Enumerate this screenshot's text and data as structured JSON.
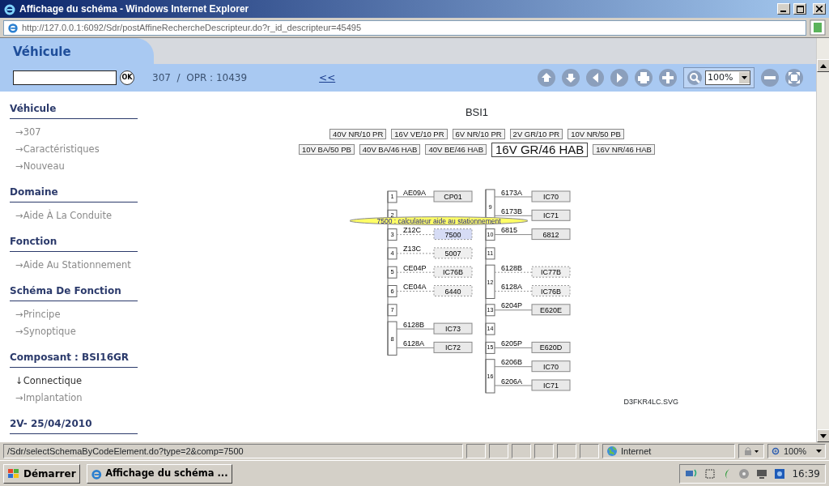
{
  "window": {
    "title": "Affichage du schéma - Windows Internet Explorer"
  },
  "address_bar": {
    "url": "http://127.0.0.1:6092/Sdr/postAffineRechercheDescripteur.do?r_id_descripteur=45495"
  },
  "app": {
    "tab": "Véhicule",
    "ok_button": "OK",
    "breadcrumb": "307  /  OPR : 10439",
    "back_link": "<<",
    "zoom": "100%"
  },
  "sidebar": {
    "sections": [
      {
        "title": "Véhicule",
        "items": [
          {
            "arrow": "→",
            "label": "307",
            "selected": false
          },
          {
            "arrow": "→",
            "label": "Caractéristiques",
            "selected": false
          },
          {
            "arrow": "→",
            "label": "Nouveau",
            "selected": false
          }
        ]
      },
      {
        "title": "Domaine",
        "items": [
          {
            "arrow": "→",
            "label": "Aide À La Conduite",
            "selected": false
          }
        ]
      },
      {
        "title": "Fonction",
        "items": [
          {
            "arrow": "→",
            "label": "Aide Au Stationnement",
            "selected": false
          }
        ]
      },
      {
        "title": "Schéma De Fonction",
        "items": [
          {
            "arrow": "→",
            "label": "Principe",
            "selected": false
          },
          {
            "arrow": "→",
            "label": "Synoptique",
            "selected": false
          }
        ]
      },
      {
        "title": "Composant : BSI16GR",
        "items": [
          {
            "arrow": "↓",
            "label": "Connectique",
            "selected": true
          },
          {
            "arrow": "→",
            "label": "Implantation",
            "selected": false
          }
        ]
      },
      {
        "title": "2V- 25/04/2010"
      }
    ]
  },
  "diagram": {
    "title": "BSI1",
    "variant_rows": [
      {
        "variants": [
          {
            "label": "40V NR/10 PR",
            "selected": false
          },
          {
            "label": "16V VE/10 PR",
            "selected": false
          },
          {
            "label": "6V NR/10 PR",
            "selected": false
          },
          {
            "label": "2V GR/10 PR",
            "selected": false
          },
          {
            "label": "10V NR/50 PB",
            "selected": false
          }
        ]
      },
      {
        "variants": [
          {
            "label": "10V BA/50 PB",
            "selected": false
          },
          {
            "label": "40V BA/46 HAB",
            "selected": false
          },
          {
            "label": "40V BE/46 HAB",
            "selected": false
          },
          {
            "label": "16V GR/46 HAB",
            "selected": true
          },
          {
            "label": "16V NR/46 HAB",
            "selected": false
          }
        ]
      }
    ],
    "connectors": [
      {
        "pins": [
          {
            "number": "1",
            "wires": [
              {
                "label": "AE09A",
                "target": "CP01",
                "dashed": false,
                "highlighted": false
              }
            ]
          },
          {
            "number": "2"
          },
          {
            "number": "3",
            "wires": [
              {
                "label": "Z12C",
                "target": "7500",
                "dashed": true,
                "highlighted": true
              }
            ]
          },
          {
            "number": "4",
            "wires": [
              {
                "label": "Z13C",
                "target": "5007",
                "dashed": true,
                "highlighted": false
              }
            ]
          },
          {
            "number": "5",
            "wires": [
              {
                "label": "CE04P",
                "target": "IC76B",
                "dashed": true,
                "highlighted": false
              }
            ]
          },
          {
            "number": "6",
            "wires": [
              {
                "label": "CE04A",
                "target": "6440",
                "dashed": true,
                "highlighted": false
              }
            ]
          },
          {
            "number": "7"
          },
          {
            "number": "8",
            "wires": [
              {
                "label": "6128B",
                "target": "IC73",
                "dashed": false,
                "highlighted": false
              },
              {
                "label": "6128A",
                "target": "IC72",
                "dashed": false,
                "highlighted": false
              }
            ]
          }
        ]
      },
      {
        "pins": [
          {
            "number": "9",
            "wires": [
              {
                "label": "6173A",
                "target": "IC70",
                "dashed": false,
                "highlighted": false
              },
              {
                "label": "6173B",
                "target": "IC71",
                "dashed": false,
                "highlighted": false
              }
            ]
          },
          {
            "number": "10",
            "wires": [
              {
                "label": "6815",
                "target": "6812",
                "dashed": false,
                "highlighted": false
              }
            ]
          },
          {
            "number": "11"
          },
          {
            "number": "12",
            "wires": [
              {
                "label": "6128B",
                "target": "IC77B",
                "dashed": true,
                "highlighted": false
              },
              {
                "label": "6128A",
                "target": "IC76B",
                "dashed": true,
                "highlighted": false
              }
            ]
          },
          {
            "number": "13",
            "wires": [
              {
                "label": "6204P",
                "target": "E620E",
                "dashed": false,
                "highlighted": false
              }
            ]
          },
          {
            "number": "14"
          },
          {
            "number": "15",
            "wires": [
              {
                "label": "6205P",
                "target": "E620D",
                "dashed": false,
                "highlighted": false
              }
            ]
          },
          {
            "number": "16",
            "wires": [
              {
                "label": "6206B",
                "target": "IC70",
                "dashed": false,
                "highlighted": false
              },
              {
                "label": "6206A",
                "target": "IC71",
                "dashed": false,
                "highlighted": false
              }
            ]
          }
        ]
      }
    ],
    "tooltip": "7500 : calculateur aide au stationnement",
    "file_name": "D3FKR4LC.SVG"
  },
  "status_bar": {
    "text": "/Sdr/selectSchemaByCodeElement.do?type=2&comp=7500",
    "zone": "Internet",
    "zoom": "100%"
  },
  "taskbar": {
    "start": "Démarrer",
    "tasks": [
      {
        "label": "Affichage du schéma ..."
      }
    ],
    "clock": "16:39"
  }
}
